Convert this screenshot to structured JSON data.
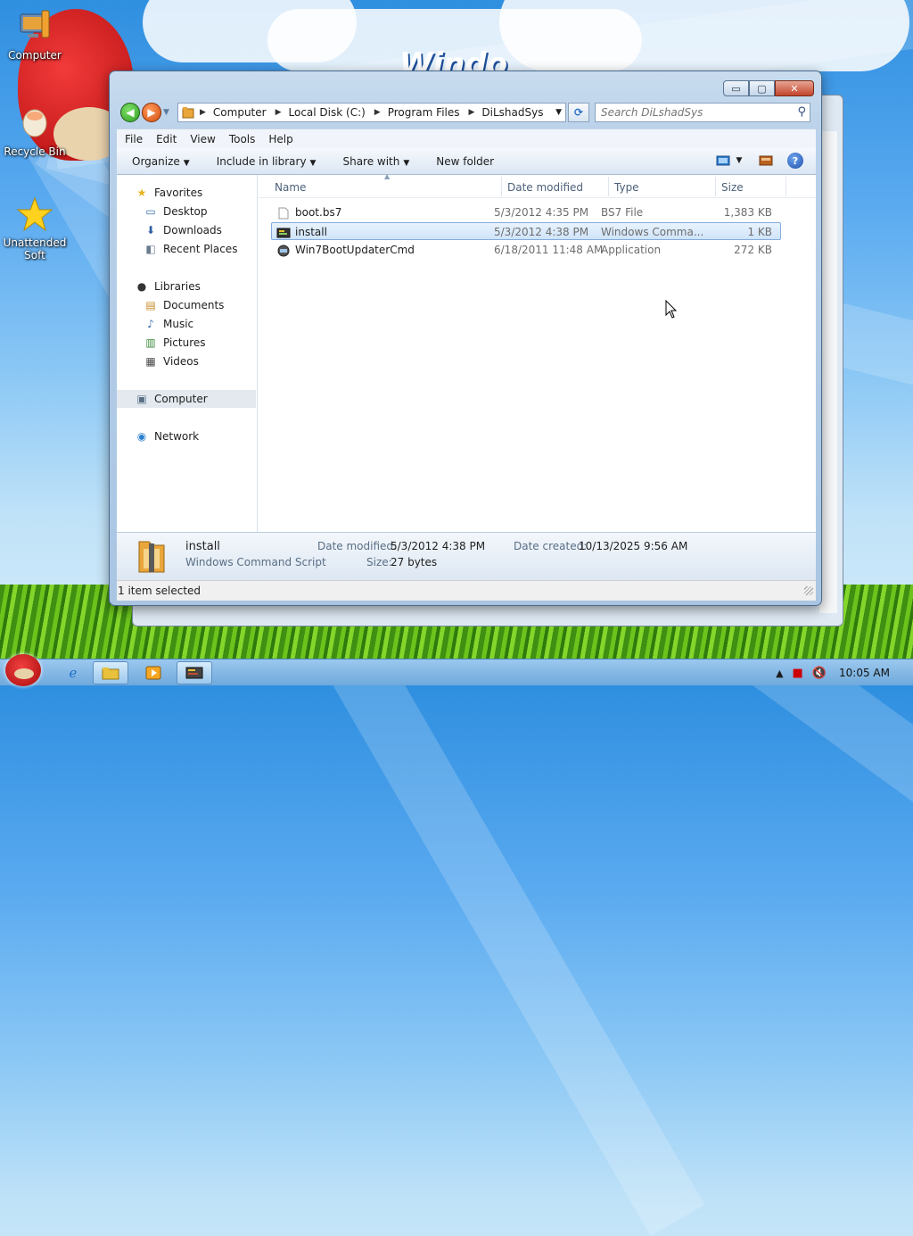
{
  "desktop": {
    "icons": [
      {
        "label": "Computer"
      },
      {
        "label": "Recycle Bin"
      },
      {
        "label": "Unattended Soft"
      }
    ],
    "wallpaper_text": "Windo"
  },
  "window": {
    "caption_buttons": {
      "minimize": "▭",
      "maximize": "▢",
      "close": "✕"
    },
    "nav": {
      "back_glyph": "◀",
      "forward_glyph": "▶"
    },
    "address": {
      "breadcrumbs": [
        "Computer",
        "Local Disk (C:)",
        "Program Files",
        "DiLshadSys"
      ]
    },
    "search": {
      "placeholder": "Search DiLshadSys"
    },
    "menu": [
      "File",
      "Edit",
      "View",
      "Tools",
      "Help"
    ],
    "toolbar": {
      "organize": "Organize",
      "include_in_library": "Include in library",
      "share_with": "Share with",
      "new_folder": "New folder",
      "help_glyph": "?"
    },
    "navpane": {
      "favorites": {
        "label": "Favorites",
        "items": [
          "Desktop",
          "Downloads",
          "Recent Places"
        ]
      },
      "libraries": {
        "label": "Libraries",
        "items": [
          "Documents",
          "Music",
          "Pictures",
          "Videos"
        ]
      },
      "computer": "Computer",
      "network": "Network"
    },
    "columns": {
      "name": "Name",
      "date_modified": "Date modified",
      "type": "Type",
      "size": "Size"
    },
    "files": [
      {
        "name": "boot.bs7",
        "date": "5/3/2012 4:35 PM",
        "type": "BS7 File",
        "size": "1,383 KB",
        "icon": "file-icon"
      },
      {
        "name": "install",
        "date": "5/3/2012 4:38 PM",
        "type": "Windows Comma...",
        "size": "1 KB",
        "icon": "script-icon"
      },
      {
        "name": "Win7BootUpdaterCmd",
        "date": "6/18/2011 11:48 AM",
        "type": "Application",
        "size": "272 KB",
        "icon": "app-icon"
      }
    ],
    "details": {
      "name": "install",
      "type": "Windows Command Script",
      "date_modified_label": "Date modified:",
      "date_modified": "5/3/2012 4:38 PM",
      "size_label": "Size:",
      "size": "27 bytes",
      "date_created_label": "Date created:",
      "date_created": "10/13/2025 9:56 AM"
    },
    "status": "1 item selected"
  },
  "taskbar": {
    "clock": "10:05 AM"
  },
  "colors": {
    "selection": "#cfe4fa",
    "selection_border": "#84acdd",
    "window_frame": "#b9d1ea",
    "taskbar": "#7fb3e2"
  }
}
